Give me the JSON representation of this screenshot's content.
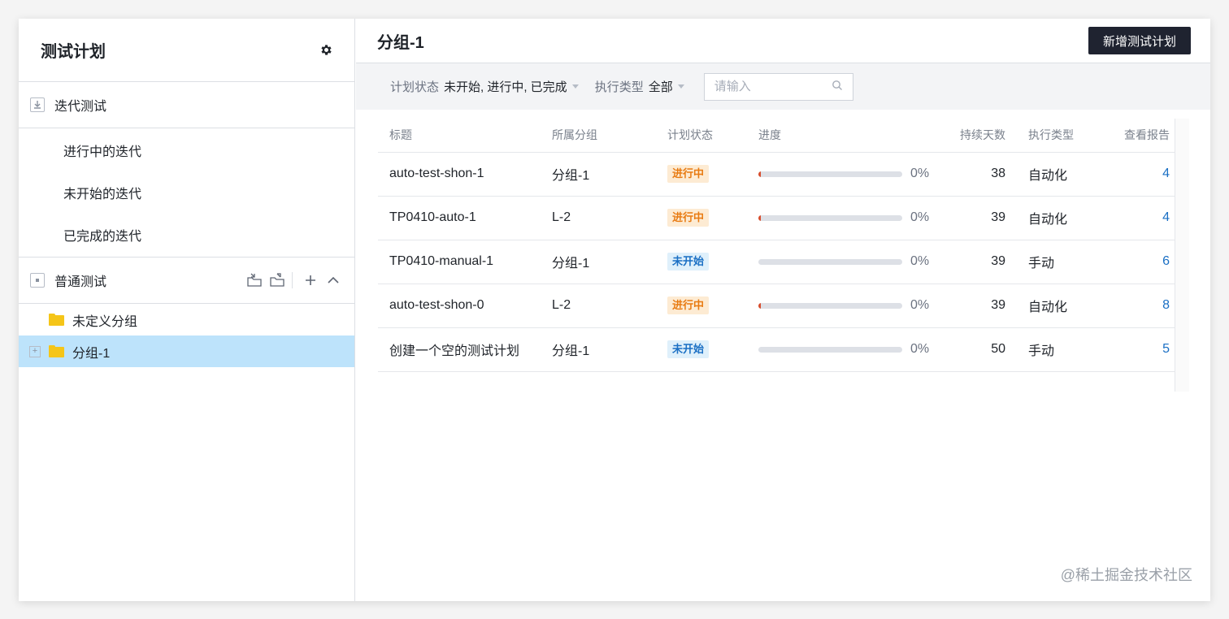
{
  "sidebar": {
    "title": "测试计划",
    "iteration_section": "迭代测试",
    "iteration_items": [
      {
        "label": "进行中的迭代"
      },
      {
        "label": "未开始的迭代"
      },
      {
        "label": "已完成的迭代"
      }
    ],
    "normal_section": "普通测试",
    "tree": [
      {
        "label": "未定义分组"
      },
      {
        "label": "分组-1"
      }
    ]
  },
  "main": {
    "title": "分组-1",
    "new_button": "新增测试计划",
    "filters": {
      "status_label": "计划状态",
      "status_value": "未开始, 进行中, 已完成",
      "type_label": "执行类型",
      "type_value": "全部",
      "search_placeholder": "请输入"
    },
    "table": {
      "headers": [
        "标题",
        "所属分组",
        "计划状态",
        "进度",
        "持续天数",
        "执行类型",
        "查看报告"
      ],
      "rows": [
        {
          "title": "auto-test-shon-1",
          "group": "分组-1",
          "status": "进行中",
          "progress": "0%",
          "days": "38",
          "type": "自动化",
          "report": "4"
        },
        {
          "title": "TP0410-auto-1",
          "group": "L-2",
          "status": "进行中",
          "progress": "0%",
          "days": "39",
          "type": "自动化",
          "report": "4"
        },
        {
          "title": "TP0410-manual-1",
          "group": "分组-1",
          "status": "未开始",
          "progress": "0%",
          "days": "39",
          "type": "手动",
          "report": "6"
        },
        {
          "title": "auto-test-shon-0",
          "group": "L-2",
          "status": "进行中",
          "progress": "0%",
          "days": "39",
          "type": "自动化",
          "report": "8"
        },
        {
          "title": "创建一个空的测试计划",
          "group": "分组-1",
          "status": "未开始",
          "progress": "0%",
          "days": "50",
          "type": "手动",
          "report": "5"
        }
      ]
    }
  },
  "watermark": "@稀土掘金技术社区",
  "colors": {
    "selected_bg": "#bde3fb",
    "primary_btn": "#1f2330",
    "tag_running_bg": "#fdebd3",
    "tag_running_fg": "#e87b12",
    "tag_new_bg": "#dff0fb",
    "tag_new_fg": "#1a6fc4",
    "link": "#1a6fc4",
    "folder": "#f5c518"
  },
  "icons": [
    "gear-icon",
    "iteration-section-icon",
    "normal-section-icon",
    "import-icon",
    "export-icon",
    "plus-icon",
    "chevron-up-icon",
    "expand-icon",
    "folder-icon",
    "search-icon",
    "caret-down-icon"
  ]
}
